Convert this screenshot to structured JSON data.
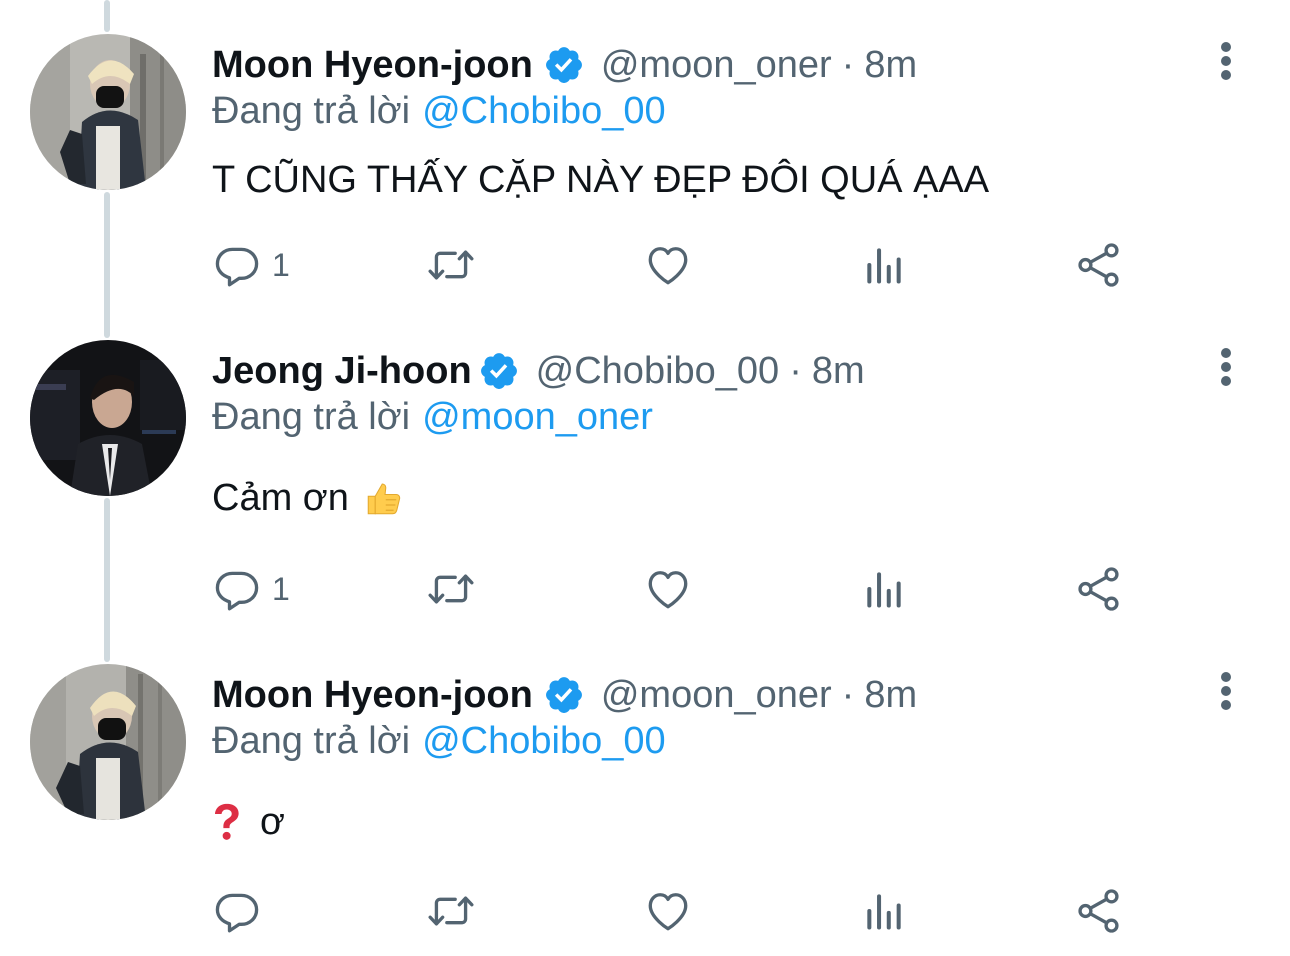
{
  "tweets": [
    {
      "name": "Moon Hyeon-joon",
      "handle": "@moon_oner",
      "separator": "·",
      "time": "8m",
      "replying_prefix": "Đang trả lời",
      "replying_to": "@Chobibo_00",
      "text": "T CŨNG THẤY CẶP NÀY ĐẸP ĐÔI QUÁ ẠAA",
      "reply_count": "1",
      "emoji": ""
    },
    {
      "name": "Jeong Ji-hoon",
      "handle": "@Chobibo_00",
      "separator": "·",
      "time": "8m",
      "replying_prefix": "Đang trả lời",
      "replying_to": "@moon_oner",
      "text": "Cảm ơn",
      "reply_count": "1",
      "emoji": "thumbs-up"
    },
    {
      "name": "Moon Hyeon-joon",
      "handle": "@moon_oner",
      "separator": "·",
      "time": "8m",
      "replying_prefix": "Đang trả lời",
      "replying_to": "@Chobibo_00",
      "text": "ơ",
      "reply_count": "",
      "emoji": "red-question-mark"
    }
  ],
  "colors": {
    "accent": "#1d9bf0",
    "secondary_text": "#536471",
    "icon": "#536471",
    "thread_line": "#cfd9de"
  }
}
